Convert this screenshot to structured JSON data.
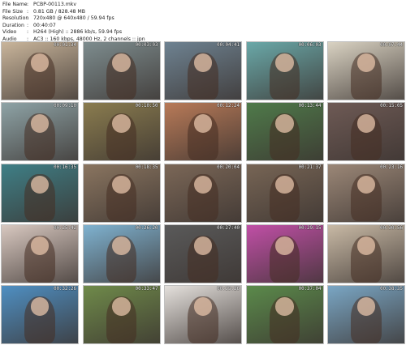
{
  "header": {
    "file_name": {
      "key": "File Name",
      "value": "PCBP-00113.mkv"
    },
    "file_size": {
      "key": "File Size",
      "value": "0.81 GB / 828.48 MB"
    },
    "resolution": {
      "key": "Resolution",
      "value": "720x480 @ 640x480 / 59.94 fps"
    },
    "duration": {
      "key": "Duration",
      "value": "00:40:07"
    },
    "video": {
      "key": "Video",
      "value": "H264 (High) :: 2886 kb/s, 59.94 fps"
    },
    "audio": {
      "key": "Audio",
      "value": "AC3 :: 160 kbps, 48000 Hz, 2 channels :: jpn"
    }
  },
  "thumbnails": [
    {
      "time": "00:01:34",
      "color": "#c9b59b"
    },
    {
      "time": "00:03:03",
      "color": "#7d8c8e"
    },
    {
      "time": "00:04:41",
      "color": "#6e8291"
    },
    {
      "time": "00:06:03",
      "color": "#6aa8a8"
    },
    {
      "time": "00:07:44",
      "color": "#d9d2c2"
    },
    {
      "time": "00:09:10",
      "color": "#8ea3a6"
    },
    {
      "time": "00:10:50",
      "color": "#8a7c4f"
    },
    {
      "time": "00:12:24",
      "color": "#b87a58"
    },
    {
      "time": "00:13:44",
      "color": "#4f7a4a"
    },
    {
      "time": "00:15:05",
      "color": "#6e5a55"
    },
    {
      "time": "00:16:35",
      "color": "#3f7f86"
    },
    {
      "time": "00:18:35",
      "color": "#8a7560"
    },
    {
      "time": "00:20:04",
      "color": "#7b6757"
    },
    {
      "time": "00:21:37",
      "color": "#776555"
    },
    {
      "time": "00:23:16",
      "color": "#9b8777"
    },
    {
      "time": "00:25:42",
      "color": "#d8c8c0"
    },
    {
      "time": "00:26:20",
      "color": "#7fb2d0"
    },
    {
      "time": "00:27:40",
      "color": "#5a5a5a"
    },
    {
      "time": "00:29:15",
      "color": "#c04fa6"
    },
    {
      "time": "00:30:56",
      "color": "#c8b9a5"
    },
    {
      "time": "00:32:26",
      "color": "#4f8fc2"
    },
    {
      "time": "00:33:47",
      "color": "#6f8a4a"
    },
    {
      "time": "00:35:26",
      "color": "#e4e0dc"
    },
    {
      "time": "00:37:04",
      "color": "#5b8a4b"
    },
    {
      "time": "00:38:35",
      "color": "#7aa6c4"
    }
  ]
}
